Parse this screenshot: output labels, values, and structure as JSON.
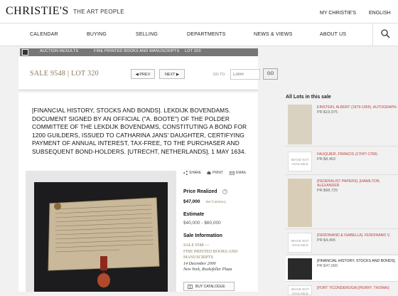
{
  "brand": {
    "logo": "CHRISTIE'S",
    "tagline": "THE ART PEOPLE"
  },
  "header_links": {
    "my_christies": "MY CHRISTIE'S",
    "language": "ENGLISH"
  },
  "nav": [
    "CALENDAR",
    "BUYING",
    "SELLING",
    "DEPARTMENTS",
    "NEWS & VIEWS",
    "ABOUT US"
  ],
  "breadcrumb": [
    "AUCTION RESULTS",
    "FINE PRINTED BOOKS AND MANUSCRIPTS",
    "LOT 320"
  ],
  "sale": {
    "sale_label": "SALE 9548",
    "lot_label": "LOT 320",
    "prev": "PREV",
    "next": "NEXT",
    "goto": "GO TO:",
    "lot_placeholder": "Lot##",
    "go": "GO"
  },
  "lot": {
    "title": "[FINANCIAL HISTORY, STOCKS AND BONDS]. LEKDIJK BOVENDAMS. DOCUMENT SIGNED BY AN OFFICIAL (\"A. BOOTE\") OF THE POLDER COMMITTEE OF THE LEKDIJK BOVENDAMS, CONSTITUTING A BOND FOR 1200 GUILDERS, ISSUED TO CATHARINA JANS' DAUGHTER, CERTIFYING PAYMENT OF ANNUAL INTEREST, TAX-FREE, TO THE PURCHASER AND SUBSEQUENT BOND-HOLDERS. [UTRECHT, NETHERLANDS], 1 MAY 1634."
  },
  "actions": {
    "share": "SHARE",
    "print": "PRINT",
    "email": "EMAIL"
  },
  "price": {
    "label": "Price Realized",
    "help": "?",
    "value": "$47,000",
    "currency_link": "Set Currency"
  },
  "estimate": {
    "label": "Estimate",
    "value": "$40,000 - $60,000"
  },
  "sale_info": {
    "label": "Sale Information",
    "line1": "SALE 9548 —",
    "line2": "FINE PRINTED BOOKS AND",
    "line3": "MANUSCRIPTS",
    "date": "14 December 2000",
    "place": "New York, Rockefeller Plaza"
  },
  "catalogue_button": "BUY CATALOGUE",
  "sidebar": {
    "heading": "All Lots in this sale",
    "lots": [
      {
        "name": "EINSTEIN, ALBERT (1879-1955). AUTOGRAPH",
        "price": "PR:$19,975",
        "noimg": false
      },
      {
        "name": "FAUQUIER, FRANCIS (1704?-1768).",
        "price": "PR:$8,463",
        "noimg": true,
        "noimg_text": "IMAGE NOT AVAILABLE"
      },
      {
        "name": "[FEDERALIST PAPERS]. [HAMILTON, ALEXANDER",
        "price": "PR:$68,725",
        "noimg": false
      },
      {
        "name": "[FERDINAND & ISABELLA]. FERDINAND V,",
        "price": "PR:$4,465",
        "noimg": true,
        "noimg_text": "IMAGE NOT AVAILABLE"
      },
      {
        "name": "[FINANCIAL HISTORY, STOCKS AND BONDS].",
        "price": "PR:$47,000",
        "noimg": false
      },
      {
        "name": "[FORT TICONDEROGA] [PERRY, THOMAS",
        "price": "",
        "noimg": true,
        "noimg_text": "IMAGE NOT AVAILABLE"
      }
    ]
  },
  "colors": {
    "accent": "#8a7a5a",
    "link_red": "#c24040",
    "breadcrumb_bg": "#777777"
  }
}
